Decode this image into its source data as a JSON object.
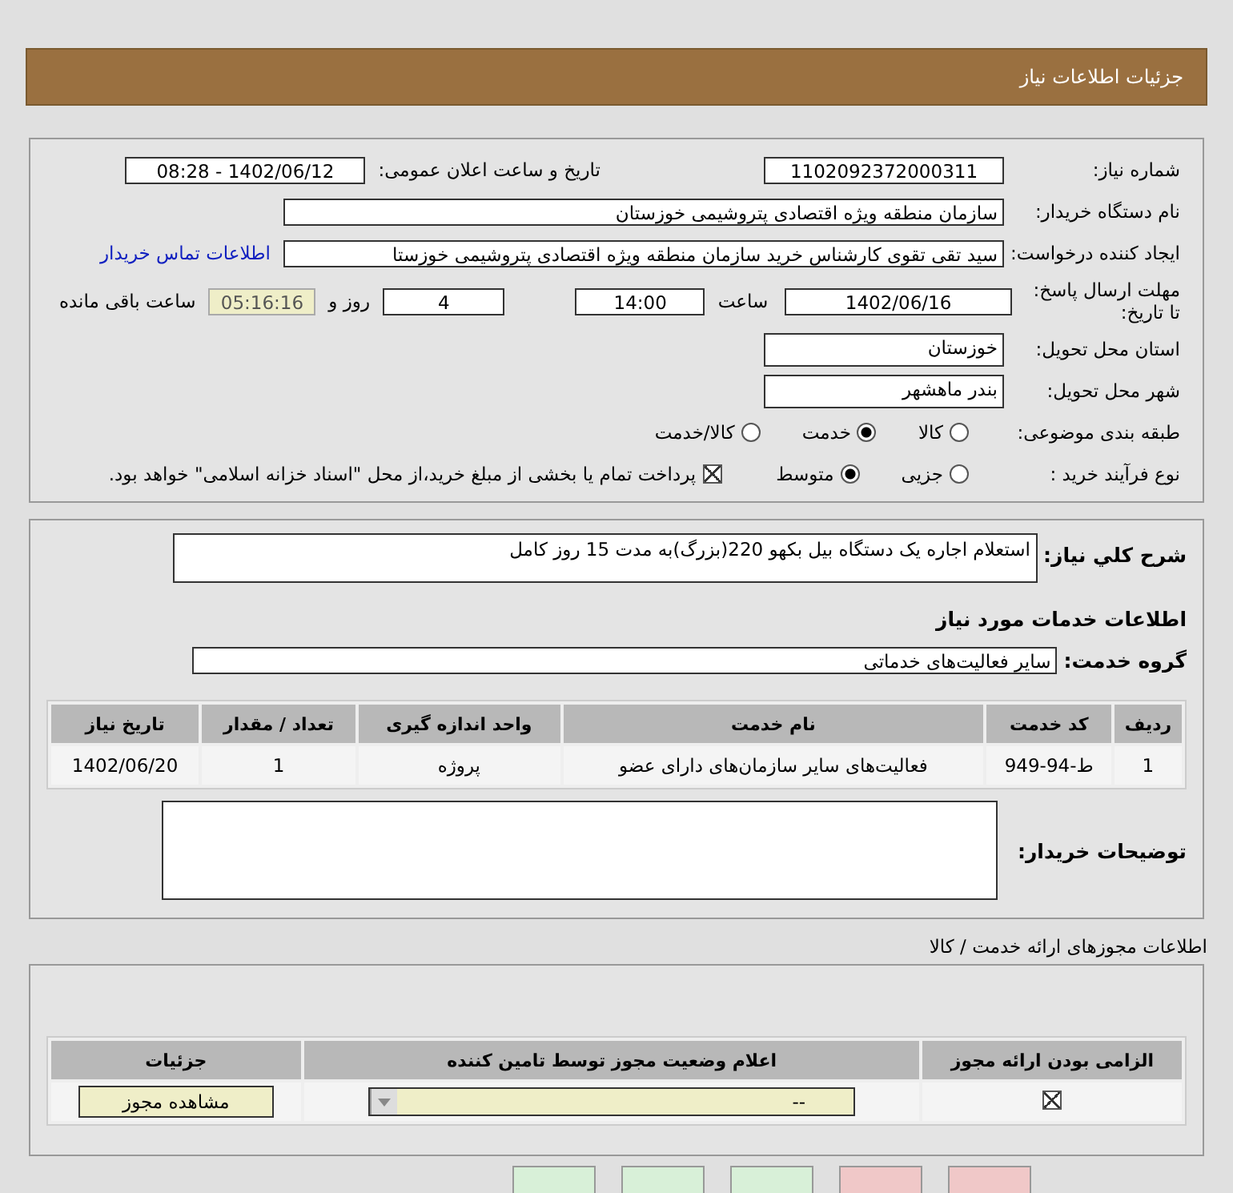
{
  "header": {
    "title": "جزئیات اطلاعات نیاز"
  },
  "need_number": {
    "label": "شماره نیاز:",
    "value": "1102092372000311"
  },
  "announce": {
    "label": "تاریخ و ساعت اعلان عمومی:",
    "value": "1402/06/12 - 08:28"
  },
  "buyer_org": {
    "label": "نام دستگاه خریدار:",
    "value": "سازمان منطقه ویژه اقتصادی پتروشیمی خوزستان"
  },
  "requester": {
    "label": "ایجاد کننده درخواست:",
    "value": "سید تقی تقوی کارشناس خرید سازمان منطقه ویژه اقتصادی پتروشیمی خوزستا",
    "link": "اطلاعات تماس خریدار"
  },
  "deadline": {
    "label": "مهلت ارسال پاسخ: تا تاریخ:",
    "date": "1402/06/16",
    "time_label": "ساعت",
    "time": "14:00",
    "days": "4",
    "days_label": "روز و",
    "remaining": "05:16:16",
    "remaining_label": "ساعت باقی مانده"
  },
  "province": {
    "label": "استان محل تحویل:",
    "value": "خوزستان"
  },
  "city": {
    "label": "شهر محل تحویل:",
    "value": "بندر ماهشهر"
  },
  "category": {
    "label": "طبقه بندی موضوعی:",
    "options": [
      {
        "label": "کالا",
        "selected": false
      },
      {
        "label": "خدمت",
        "selected": true
      },
      {
        "label": "کالا/خدمت",
        "selected": false
      }
    ]
  },
  "process": {
    "label": "نوع فرآیند خرید :",
    "options": [
      {
        "label": "جزیی",
        "selected": false
      },
      {
        "label": "متوسط",
        "selected": true
      }
    ],
    "checkbox": {
      "checked": true,
      "text": "پرداخت تمام یا بخشی از مبلغ خرید،از محل \"اسناد خزانه اسلامی\" خواهد بود."
    }
  },
  "description": {
    "label": "شرح کلي نياز:",
    "value": "استعلام اجاره یک دستگاه بیل بکهو 220(بزرگ)به مدت 15 روز کامل"
  },
  "services_title": "اطلاعات خدمات مورد نیاز",
  "service_group": {
    "label": "گروه خدمت:",
    "value": "سایر فعالیت‌های خدماتی"
  },
  "services_table": {
    "columns": [
      "ردیف",
      "کد خدمت",
      "نام خدمت",
      "واحد اندازه گیری",
      "تعداد / مقدار",
      "تاریخ نیاز"
    ],
    "rows": [
      [
        "1",
        "ط-94-949",
        "فعالیت‌های سایر سازمان‌های دارای عضو",
        "پروژه",
        "1",
        "1402/06/20"
      ]
    ]
  },
  "buyer_notes": {
    "label": "توضیحات خریدار:"
  },
  "permits_title": "اطلاعات مجوزهای ارائه خدمت / کالا",
  "permits_table": {
    "columns": [
      "الزامی بودن ارائه مجوز",
      "اعلام وضعیت مجوز توسط تامین کننده",
      "جزئیات"
    ],
    "rows": [
      {
        "required": true,
        "status": "--",
        "button": "مشاهده مجوز"
      }
    ]
  },
  "bottom_buttons": [
    {
      "color": "#f0c8c8"
    },
    {
      "color": "#f0c8c8"
    },
    {
      "color": "#d8f0d8"
    },
    {
      "color": "#d8f0d8"
    },
    {
      "color": "#d8f0d8"
    }
  ]
}
